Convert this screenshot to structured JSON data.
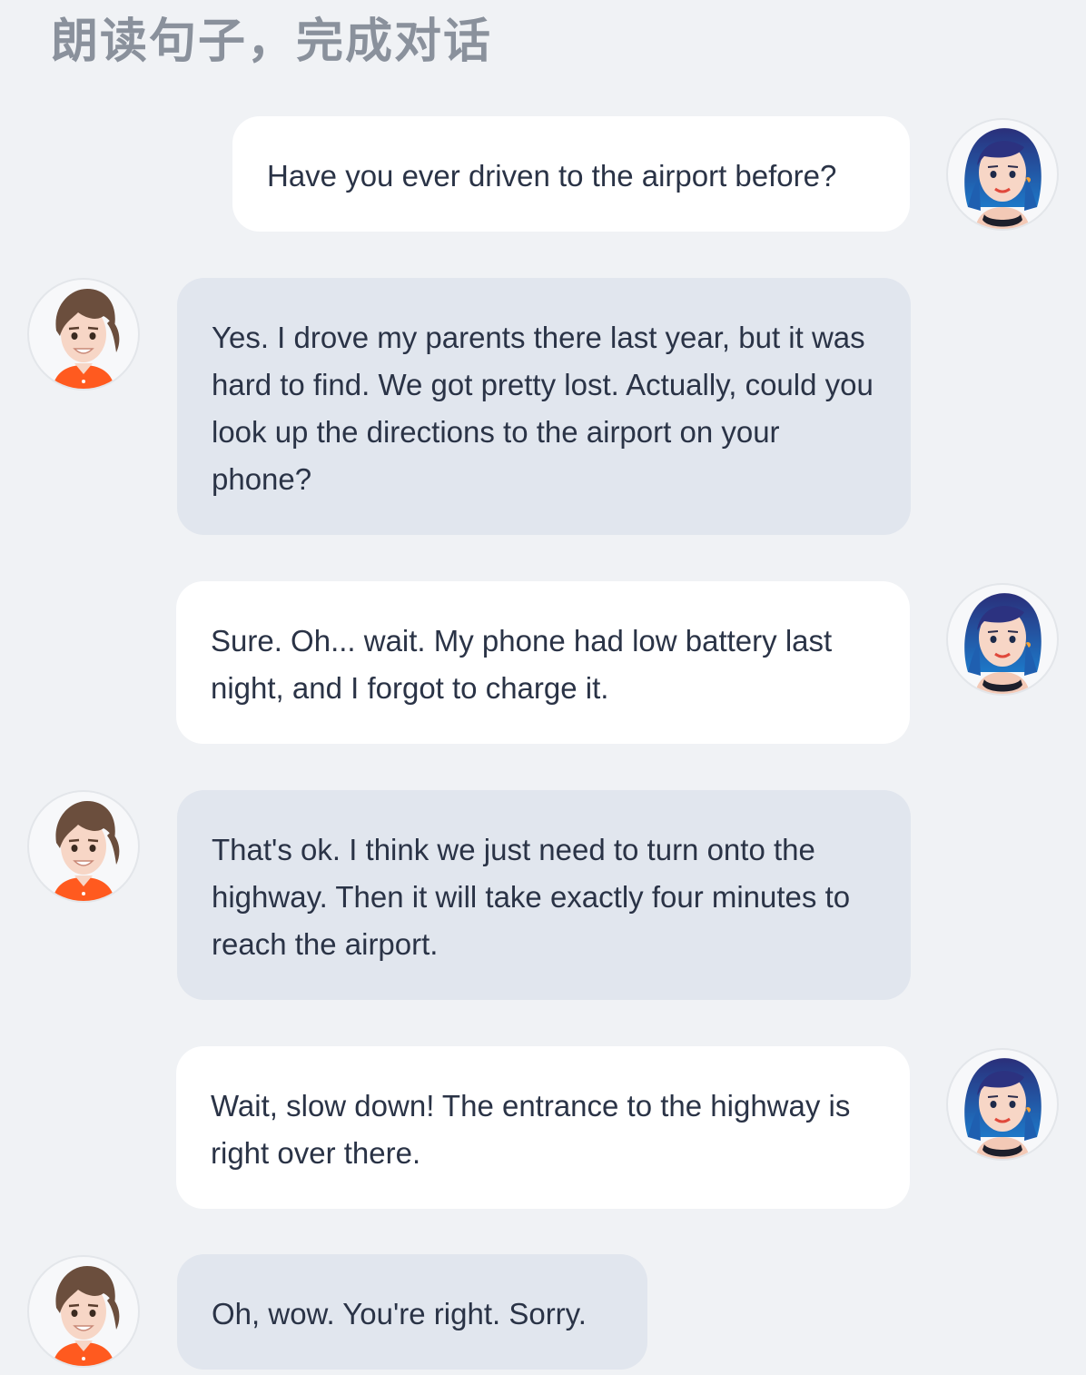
{
  "header": {
    "title": "朗读句子，完成对话"
  },
  "icons": {
    "speaker_a": "woman-blue-hair-avatar-icon",
    "speaker_b": "man-orange-shirt-avatar-icon"
  },
  "colors": {
    "background": "#f0f2f5",
    "bubble_right": "#ffffff",
    "bubble_left": "#e1e6ee",
    "text": "#2a3346",
    "title": "#8a919c"
  },
  "conversation": {
    "messages": [
      {
        "speaker": "A",
        "side": "right",
        "text": "Have you ever driven to the airport before?"
      },
      {
        "speaker": "B",
        "side": "left",
        "text": "Yes. I drove my parents there last year, but it was hard to find. We got pretty lost. Actually, could you look up the directions to the airport on your phone?"
      },
      {
        "speaker": "A",
        "side": "right",
        "text": "Sure. Oh... wait. My phone had low battery last night, and I forgot to charge it."
      },
      {
        "speaker": "B",
        "side": "left",
        "text": "That's ok. I think we just need to turn onto the highway. Then it will take exactly four minutes to reach the airport."
      },
      {
        "speaker": "A",
        "side": "right",
        "text": "Wait, slow down! The entrance to the highway is right over there."
      },
      {
        "speaker": "B",
        "side": "left",
        "text": "Oh, wow. You're right. Sorry."
      }
    ]
  }
}
